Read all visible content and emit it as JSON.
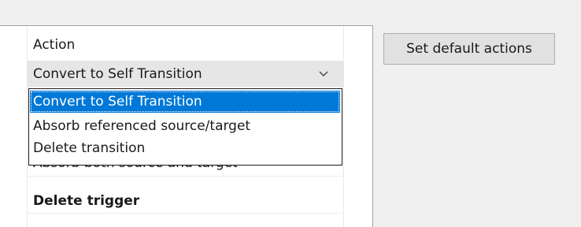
{
  "table": {
    "header": "Action",
    "current_value": "Convert to Self Transition",
    "rows": [
      "Absorb both source and target",
      "Delete trigger"
    ]
  },
  "dropdown": {
    "options": [
      "Convert to Self Transition",
      "Absorb referenced source/target",
      "Delete transition"
    ]
  },
  "buttons": {
    "set_default": "Set default actions"
  },
  "colors": {
    "selection": "#0078d7",
    "button_bg": "#e1e1e1"
  },
  "icons": {
    "combo": "chevron-down-icon"
  }
}
